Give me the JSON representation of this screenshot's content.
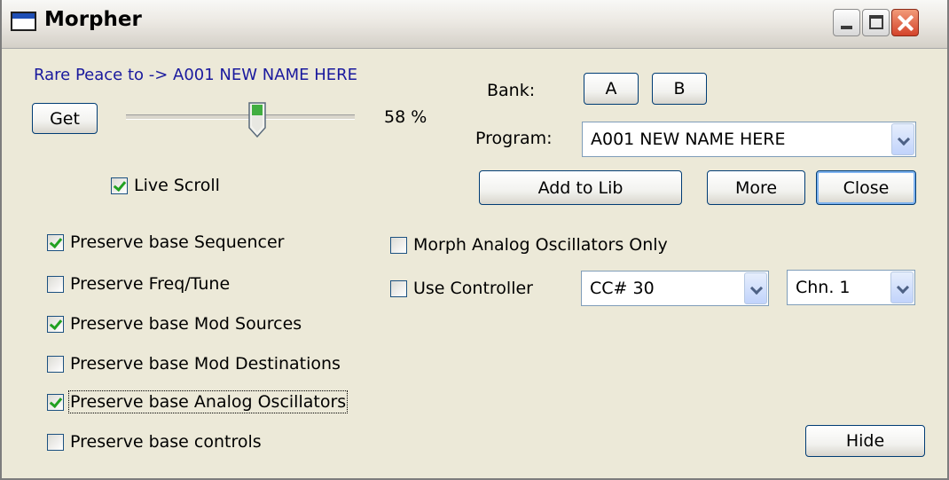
{
  "window": {
    "title": "Morpher",
    "icon": "window-app-icon",
    "controls": [
      "minimize-icon",
      "maximize-icon",
      "close-icon"
    ]
  },
  "status_line": "Rare Peace to -> A001  NEW NAME HERE",
  "get_button": "Get",
  "morph": {
    "percent_label": "58 %",
    "value": 0.58
  },
  "live_scroll": {
    "label": "Live Scroll",
    "checked": true
  },
  "bank": {
    "label": "Bank:",
    "buttons": [
      "A",
      "B"
    ]
  },
  "program": {
    "label": "Program:",
    "value": "A001  NEW NAME HERE"
  },
  "actions": {
    "add_to_lib": "Add to Lib",
    "more": "More",
    "close": "Close",
    "hide": "Hide"
  },
  "preserve_options": [
    {
      "label": "Preserve base Sequencer",
      "checked": true
    },
    {
      "label": "Preserve Freq/Tune",
      "checked": false
    },
    {
      "label": "Preserve base Mod Sources",
      "checked": true
    },
    {
      "label": "Preserve base Mod Destinations",
      "checked": false
    },
    {
      "label": "Preserve base Analog Oscillators",
      "checked": true
    },
    {
      "label": "Preserve base controls",
      "checked": false
    }
  ],
  "morph_analog_only": {
    "label": "Morph Analog Oscillators Only",
    "checked": false
  },
  "use_controller": {
    "label": "Use Controller",
    "checked": false
  },
  "controller_select": {
    "value": "CC# 30"
  },
  "channel_select": {
    "value": "Chn. 1"
  },
  "colors": {
    "status_text": "#1a1a9e",
    "window_bg": "#ece9d8",
    "check_mark": "#21a121",
    "close_button": "#d3432b"
  }
}
